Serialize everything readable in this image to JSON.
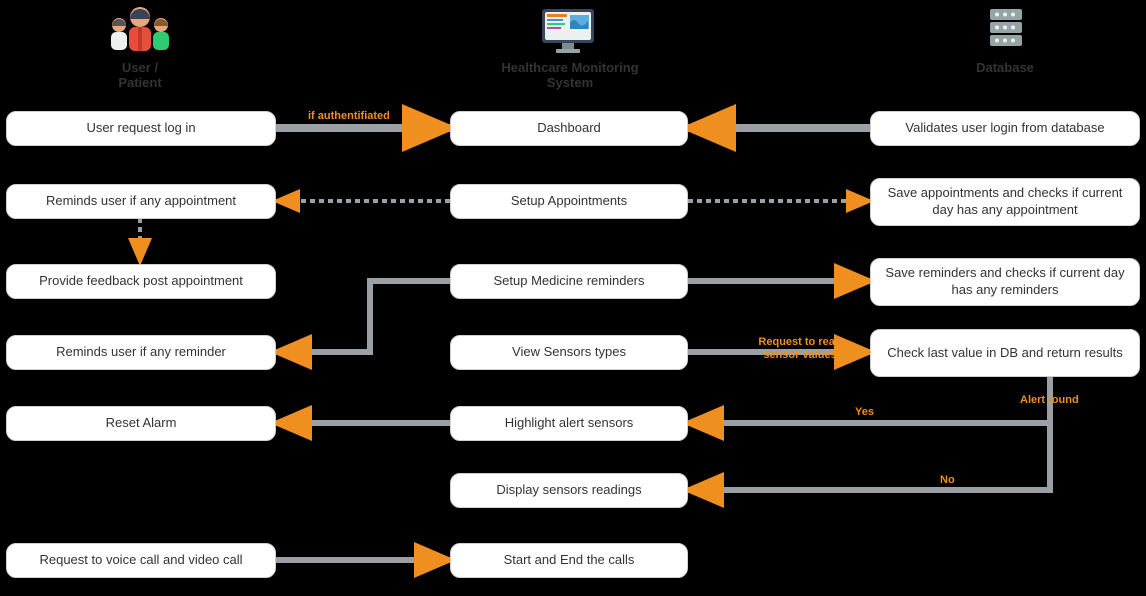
{
  "lanes": {
    "user": {
      "title": "User / Patient"
    },
    "system": {
      "title": "Healthcare Monitoring System"
    },
    "db": {
      "title": "Database"
    }
  },
  "nodes": {
    "u1": "User request log in",
    "u2": "Reminds user if any appointment",
    "u3": "Provide feedback post appointment",
    "u4": "Reminds user if any reminder",
    "u5": "Reset Alarm",
    "u6": "Request to voice call and video call",
    "s1": "Dashboard",
    "s2": "Setup Appointments",
    "s3": "Setup Medicine reminders",
    "s4": "View Sensors types",
    "s5": "Highlight alert sensors",
    "s6": "Display sensors readings",
    "s7": "Start and End the calls",
    "d1": "Validates user login from database",
    "d2": "Save appointments and checks if current day has any appointment",
    "d3": "Save reminders and checks if current day has any reminders",
    "d4": "Check last value in DB and return results"
  },
  "edgeLabels": {
    "e1": "if authentifiated",
    "e2": "Request to read sensor values",
    "e3": "Alert found",
    "e4": "Yes",
    "e5": "No"
  }
}
